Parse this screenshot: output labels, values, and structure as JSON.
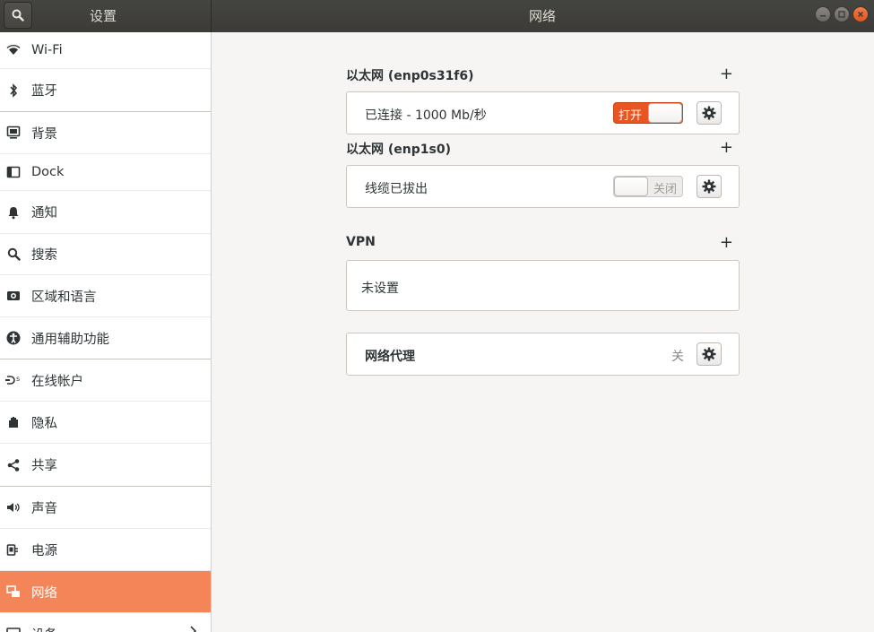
{
  "header": {
    "left_title": "设置",
    "main_title": "网络"
  },
  "sidebar": {
    "items": [
      {
        "label": "Wi-Fi",
        "icon": "wifi-icon"
      },
      {
        "label": "蓝牙",
        "icon": "bluetooth-icon"
      },
      {
        "label": "背景",
        "icon": "background-icon"
      },
      {
        "label": "Dock",
        "icon": "dock-icon"
      },
      {
        "label": "通知",
        "icon": "bell-icon"
      },
      {
        "label": "搜索",
        "icon": "search-icon"
      },
      {
        "label": "区域和语言",
        "icon": "region-icon"
      },
      {
        "label": "通用辅助功能",
        "icon": "accessibility-icon"
      },
      {
        "label": "在线帐户",
        "icon": "online-accounts-icon"
      },
      {
        "label": "隐私",
        "icon": "hand-icon"
      },
      {
        "label": "共享",
        "icon": "share-icon"
      },
      {
        "label": "声音",
        "icon": "speaker-icon"
      },
      {
        "label": "电源",
        "icon": "power-icon"
      },
      {
        "label": "网络",
        "icon": "network-icon",
        "active": true
      },
      {
        "label": "设备",
        "icon": "devices-icon"
      }
    ]
  },
  "main": {
    "ethernet1": {
      "title": "以太网 (enp0s31f6)",
      "plus": "+",
      "status": "已连接 - 1000 Mb/秒",
      "switch_label": "打开"
    },
    "ethernet2": {
      "title": "以太网 (enp1s0)",
      "plus": "+",
      "status": "线缆已拔出",
      "switch_label": "关闭"
    },
    "vpn": {
      "title": "VPN",
      "plus": "+",
      "status": "未设置"
    },
    "proxy": {
      "label": "网络代理",
      "state": "关"
    }
  },
  "colors": {
    "accent": "#e95420",
    "sidebar_active": "#f38559",
    "header_bg": "#3c3b37"
  }
}
